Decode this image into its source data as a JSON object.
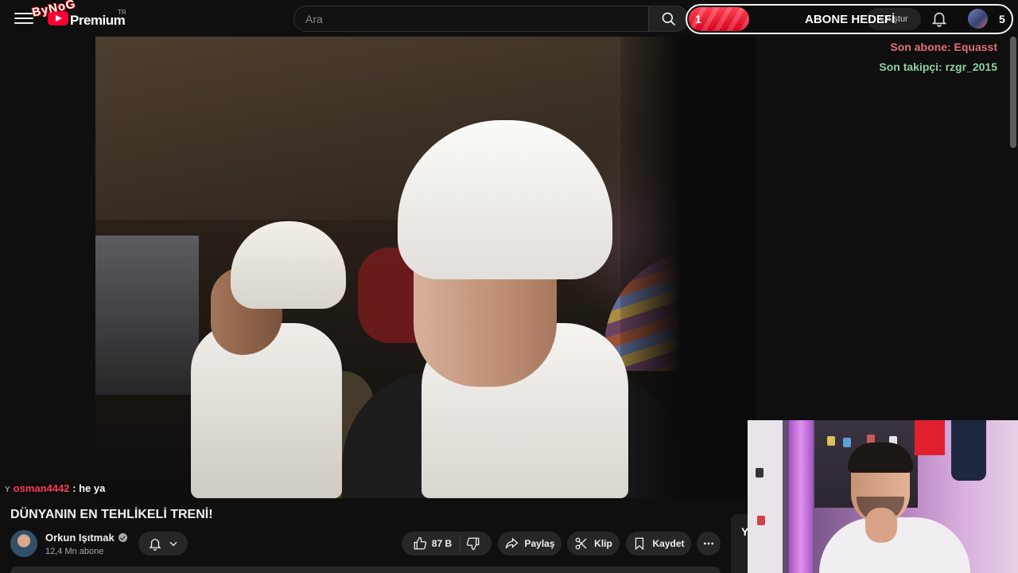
{
  "header": {
    "brand": "Premium",
    "country": "TR",
    "logo_overlay": "ByNoG",
    "search_placeholder": "Ara",
    "create_label": "Oluştur"
  },
  "overlay": {
    "goal_current": "1",
    "goal_title": "ABONE HEDEFİ",
    "goal_target": "5",
    "goal_progress": 0.2,
    "last_subscriber_label": "Son abone: Equasst",
    "last_follower_label": "Son takipçi: rzgr_2015"
  },
  "chat": {
    "user": "osman4442",
    "separator": " : ",
    "message": "he ya"
  },
  "video": {
    "title": "DÜNYANIN EN TEHLİKELİ TRENİ!",
    "channel_name": "Orkun Işıtmak",
    "subscribers": "12,4 Mn abone",
    "likes": "87 B",
    "share_label": "Paylaş",
    "clip_label": "Klip",
    "save_label": "Kaydet",
    "side_card_letter": "Y"
  },
  "colors": {
    "background": "#0f0f0f",
    "goal_fill": "#e8102a",
    "last_sub": "#e8707e",
    "last_follow": "#8fd5a4",
    "chat_user": "#ff3b5c"
  }
}
